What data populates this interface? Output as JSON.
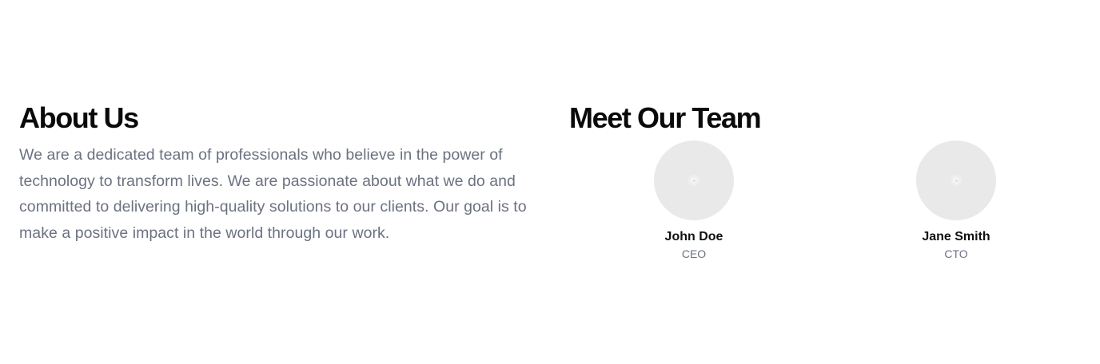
{
  "about": {
    "title": "About Us",
    "body": "We are a dedicated team of professionals who believe in the power of technology to transform lives. We are passionate about what we do and committed to delivering high-quality solutions to our clients. Our goal is to make a positive impact in the world through our work."
  },
  "team": {
    "title": "Meet Our Team",
    "members": [
      {
        "name": "John Doe",
        "role": "CEO",
        "avatar_icon": "image-placeholder-icon"
      },
      {
        "name": "Jane Smith",
        "role": "CTO",
        "avatar_icon": "image-placeholder-icon"
      }
    ]
  },
  "colors": {
    "heading": "#0a0a0a",
    "body_text": "#6b7280",
    "avatar_bg": "#e9e9e9"
  }
}
